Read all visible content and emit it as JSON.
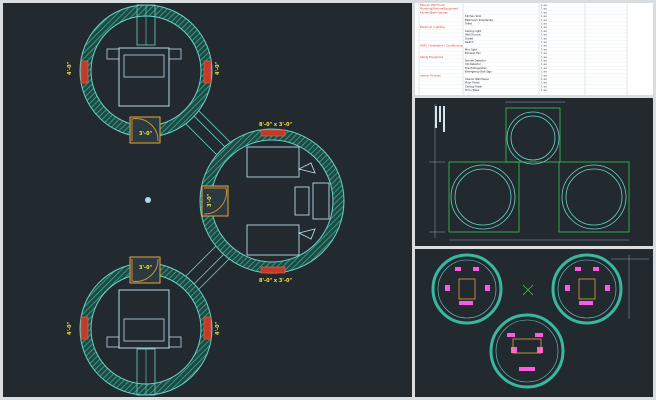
{
  "colors": {
    "background": "#222a30",
    "wall": "#39b8a0",
    "outline": "#6ad2c8",
    "door": "#e8a43a",
    "window_frame": "#c23a2a",
    "dim_text": "#f2e23a",
    "furniture": "#b8d8e8",
    "elevation_line": "#38c848",
    "magenta": "#ff5ae6"
  },
  "main": {
    "dim_labels": {
      "door_top": "3'-0\"",
      "door_left_center": "3'-0\"",
      "door_bottom": "3'-0\"",
      "center_top": "8'-0\" x 3'-0\"",
      "center_bottom": "8'-0\" x 3'-0\"",
      "top_left_side": "4'-0\"",
      "top_right_side": "4'-0\"",
      "bottom_left_side": "4'-0\"",
      "bottom_right_side": "4'-0\""
    }
  },
  "schedule": {
    "rows": [
      {
        "name": "Exterior Wall Finish",
        "desc": "",
        "qty": "1 ea"
      },
      {
        "name": "Plumbing/Fixtures/Equipment",
        "desc": "",
        "qty": "1 ea"
      },
      {
        "name": "Kitchen/Bath Fixtures",
        "desc": "",
        "qty": "1 ea"
      },
      {
        "name": "",
        "desc": "Kitchen Sink",
        "qty": "1 ea"
      },
      {
        "name": "",
        "desc": "Bathroom Sink/Vanity",
        "qty": "1 ea"
      },
      {
        "name": "",
        "desc": "Toilet",
        "qty": "1 ea"
      },
      {
        "name": "Electrical / Lighting",
        "desc": "",
        "qty": "1 ea"
      },
      {
        "name": "",
        "desc": "Ceiling Light",
        "qty": "1 ea"
      },
      {
        "name": "",
        "desc": "Wall Sconce",
        "qty": "1 ea"
      },
      {
        "name": "",
        "desc": "Outlet",
        "qty": "1 ea"
      },
      {
        "name": "",
        "desc": "Switch",
        "qty": "1 ea"
      },
      {
        "name": "HVAC / Ventilation / Conditioning",
        "desc": "",
        "qty": "1 ea"
      },
      {
        "name": "",
        "desc": "Mini Split",
        "qty": "1 ea"
      },
      {
        "name": "",
        "desc": "Exhaust Fan",
        "qty": "1 ea"
      },
      {
        "name": "Safety Equipment",
        "desc": "",
        "qty": "1 ea"
      },
      {
        "name": "",
        "desc": "Smoke Detector",
        "qty": "1 ea"
      },
      {
        "name": "",
        "desc": "CO Detector",
        "qty": "1 ea"
      },
      {
        "name": "",
        "desc": "Fire Extinguisher",
        "qty": "1 ea"
      },
      {
        "name": "",
        "desc": "Emergency Exit Sign",
        "qty": "1 ea"
      },
      {
        "name": "Interior Finishes",
        "desc": "",
        "qty": "1 ea"
      },
      {
        "name": "",
        "desc": "Interior Wall Panel",
        "qty": "1 ea"
      },
      {
        "name": "",
        "desc": "Floor Finish",
        "qty": "1 ea"
      },
      {
        "name": "",
        "desc": "Ceiling Finish",
        "qty": "1 ea"
      },
      {
        "name": "",
        "desc": "Trim / Base",
        "qty": "1 ea"
      }
    ]
  }
}
